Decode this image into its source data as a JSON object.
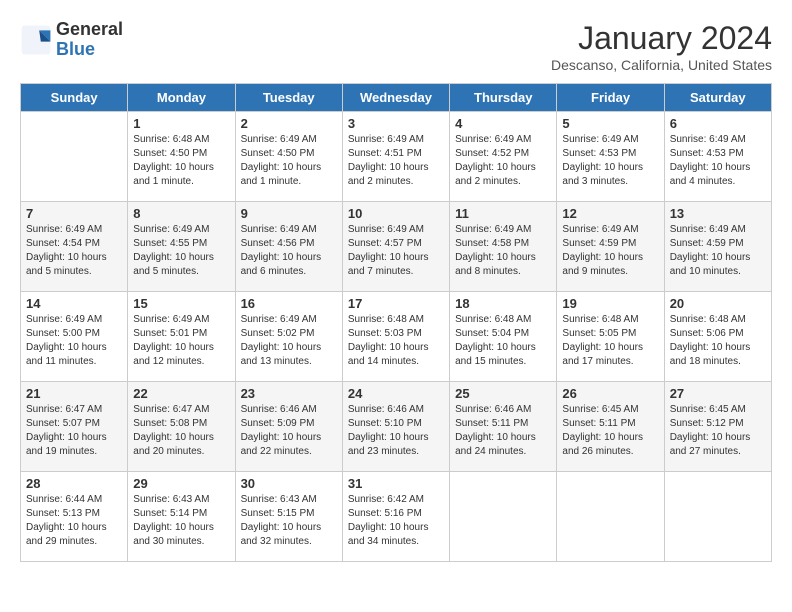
{
  "header": {
    "logo_line1": "General",
    "logo_line2": "Blue",
    "month": "January 2024",
    "location": "Descanso, California, United States"
  },
  "days_of_week": [
    "Sunday",
    "Monday",
    "Tuesday",
    "Wednesday",
    "Thursday",
    "Friday",
    "Saturday"
  ],
  "weeks": [
    [
      {
        "day": "",
        "info": ""
      },
      {
        "day": "1",
        "info": "Sunrise: 6:48 AM\nSunset: 4:50 PM\nDaylight: 10 hours\nand 1 minute."
      },
      {
        "day": "2",
        "info": "Sunrise: 6:49 AM\nSunset: 4:50 PM\nDaylight: 10 hours\nand 1 minute."
      },
      {
        "day": "3",
        "info": "Sunrise: 6:49 AM\nSunset: 4:51 PM\nDaylight: 10 hours\nand 2 minutes."
      },
      {
        "day": "4",
        "info": "Sunrise: 6:49 AM\nSunset: 4:52 PM\nDaylight: 10 hours\nand 2 minutes."
      },
      {
        "day": "5",
        "info": "Sunrise: 6:49 AM\nSunset: 4:53 PM\nDaylight: 10 hours\nand 3 minutes."
      },
      {
        "day": "6",
        "info": "Sunrise: 6:49 AM\nSunset: 4:53 PM\nDaylight: 10 hours\nand 4 minutes."
      }
    ],
    [
      {
        "day": "7",
        "info": "Sunrise: 6:49 AM\nSunset: 4:54 PM\nDaylight: 10 hours\nand 5 minutes."
      },
      {
        "day": "8",
        "info": "Sunrise: 6:49 AM\nSunset: 4:55 PM\nDaylight: 10 hours\nand 5 minutes."
      },
      {
        "day": "9",
        "info": "Sunrise: 6:49 AM\nSunset: 4:56 PM\nDaylight: 10 hours\nand 6 minutes."
      },
      {
        "day": "10",
        "info": "Sunrise: 6:49 AM\nSunset: 4:57 PM\nDaylight: 10 hours\nand 7 minutes."
      },
      {
        "day": "11",
        "info": "Sunrise: 6:49 AM\nSunset: 4:58 PM\nDaylight: 10 hours\nand 8 minutes."
      },
      {
        "day": "12",
        "info": "Sunrise: 6:49 AM\nSunset: 4:59 PM\nDaylight: 10 hours\nand 9 minutes."
      },
      {
        "day": "13",
        "info": "Sunrise: 6:49 AM\nSunset: 4:59 PM\nDaylight: 10 hours\nand 10 minutes."
      }
    ],
    [
      {
        "day": "14",
        "info": "Sunrise: 6:49 AM\nSunset: 5:00 PM\nDaylight: 10 hours\nand 11 minutes."
      },
      {
        "day": "15",
        "info": "Sunrise: 6:49 AM\nSunset: 5:01 PM\nDaylight: 10 hours\nand 12 minutes."
      },
      {
        "day": "16",
        "info": "Sunrise: 6:49 AM\nSunset: 5:02 PM\nDaylight: 10 hours\nand 13 minutes."
      },
      {
        "day": "17",
        "info": "Sunrise: 6:48 AM\nSunset: 5:03 PM\nDaylight: 10 hours\nand 14 minutes."
      },
      {
        "day": "18",
        "info": "Sunrise: 6:48 AM\nSunset: 5:04 PM\nDaylight: 10 hours\nand 15 minutes."
      },
      {
        "day": "19",
        "info": "Sunrise: 6:48 AM\nSunset: 5:05 PM\nDaylight: 10 hours\nand 17 minutes."
      },
      {
        "day": "20",
        "info": "Sunrise: 6:48 AM\nSunset: 5:06 PM\nDaylight: 10 hours\nand 18 minutes."
      }
    ],
    [
      {
        "day": "21",
        "info": "Sunrise: 6:47 AM\nSunset: 5:07 PM\nDaylight: 10 hours\nand 19 minutes."
      },
      {
        "day": "22",
        "info": "Sunrise: 6:47 AM\nSunset: 5:08 PM\nDaylight: 10 hours\nand 20 minutes."
      },
      {
        "day": "23",
        "info": "Sunrise: 6:46 AM\nSunset: 5:09 PM\nDaylight: 10 hours\nand 22 minutes."
      },
      {
        "day": "24",
        "info": "Sunrise: 6:46 AM\nSunset: 5:10 PM\nDaylight: 10 hours\nand 23 minutes."
      },
      {
        "day": "25",
        "info": "Sunrise: 6:46 AM\nSunset: 5:11 PM\nDaylight: 10 hours\nand 24 minutes."
      },
      {
        "day": "26",
        "info": "Sunrise: 6:45 AM\nSunset: 5:11 PM\nDaylight: 10 hours\nand 26 minutes."
      },
      {
        "day": "27",
        "info": "Sunrise: 6:45 AM\nSunset: 5:12 PM\nDaylight: 10 hours\nand 27 minutes."
      }
    ],
    [
      {
        "day": "28",
        "info": "Sunrise: 6:44 AM\nSunset: 5:13 PM\nDaylight: 10 hours\nand 29 minutes."
      },
      {
        "day": "29",
        "info": "Sunrise: 6:43 AM\nSunset: 5:14 PM\nDaylight: 10 hours\nand 30 minutes."
      },
      {
        "day": "30",
        "info": "Sunrise: 6:43 AM\nSunset: 5:15 PM\nDaylight: 10 hours\nand 32 minutes."
      },
      {
        "day": "31",
        "info": "Sunrise: 6:42 AM\nSunset: 5:16 PM\nDaylight: 10 hours\nand 34 minutes."
      },
      {
        "day": "",
        "info": ""
      },
      {
        "day": "",
        "info": ""
      },
      {
        "day": "",
        "info": ""
      }
    ]
  ]
}
